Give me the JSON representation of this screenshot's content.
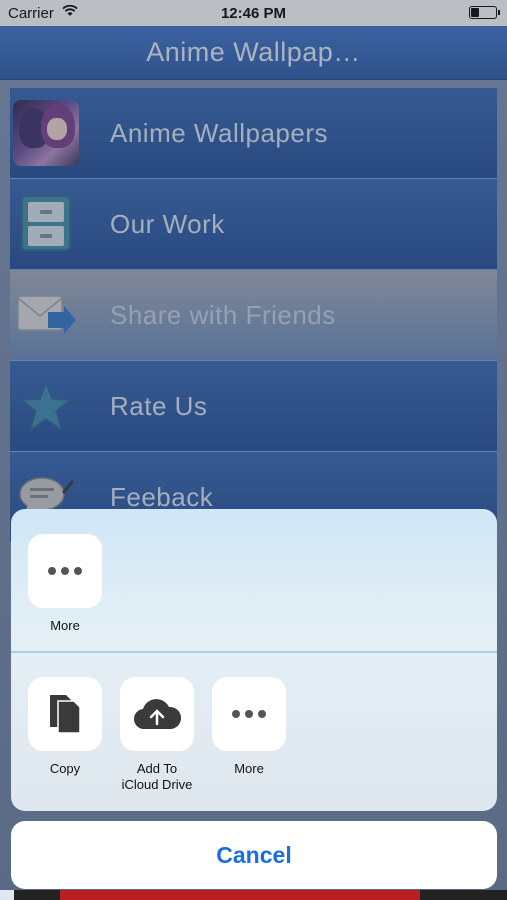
{
  "status_bar": {
    "carrier": "Carrier",
    "time": "12:46 PM"
  },
  "nav": {
    "title": "Anime Wallpap…"
  },
  "menu": {
    "items": [
      {
        "label": "Anime Wallpapers",
        "icon": "anime-thumbnail"
      },
      {
        "label": "Our Work",
        "icon": "cabinet-icon"
      },
      {
        "label": "Share with Friends",
        "icon": "share-envelope-icon"
      },
      {
        "label": "Rate Us",
        "icon": "star-icon"
      },
      {
        "label": "Feeback",
        "icon": "chat-bubble-icon"
      }
    ]
  },
  "share_sheet": {
    "top_row": [
      {
        "label": "More",
        "icon": "more-dots-icon"
      }
    ],
    "bottom_row": [
      {
        "label": "Copy",
        "icon": "copy-icon"
      },
      {
        "label": "Add To\niCloud Drive",
        "icon": "cloud-upload-icon"
      },
      {
        "label": "More",
        "icon": "more-dots-icon"
      }
    ],
    "cancel_label": "Cancel"
  }
}
